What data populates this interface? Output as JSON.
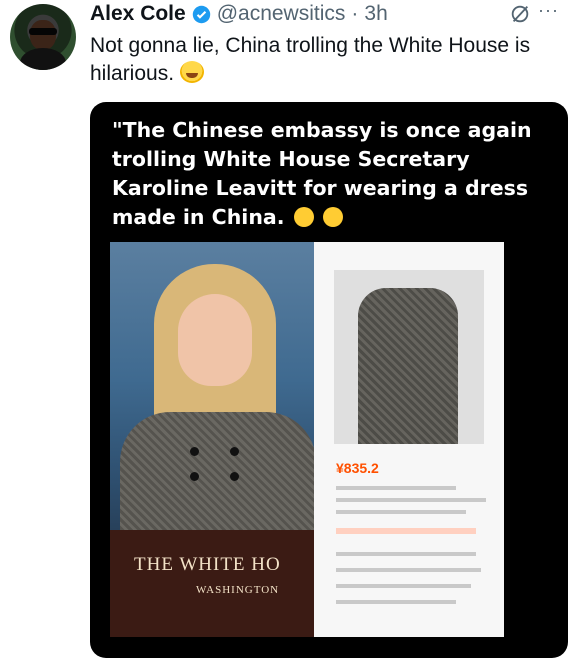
{
  "author": {
    "name": "Alex Cole",
    "handle": "@acnewsitics",
    "separator": "·",
    "time": "3h"
  },
  "tweet": {
    "text": "Not gonna lie, China trolling the White House is hilarious."
  },
  "media": {
    "caption": "\"The Chinese embassy is once again trolling White House Secretary Karoline Leavitt for wearing a dress made in China.",
    "podium_title": "THE WHITE HO",
    "podium_subtitle": "WASHINGTON",
    "price": "¥835.2"
  },
  "colors": {
    "text": "#0f1419",
    "secondary": "#536471",
    "verified": "#1d9bf0",
    "background": "#ffffff",
    "media_bg": "#000000"
  },
  "icons": {
    "verified": "verified-badge-icon",
    "grok": "grok-icon",
    "more": "more-icon",
    "emoji": "rofl-emoji"
  }
}
